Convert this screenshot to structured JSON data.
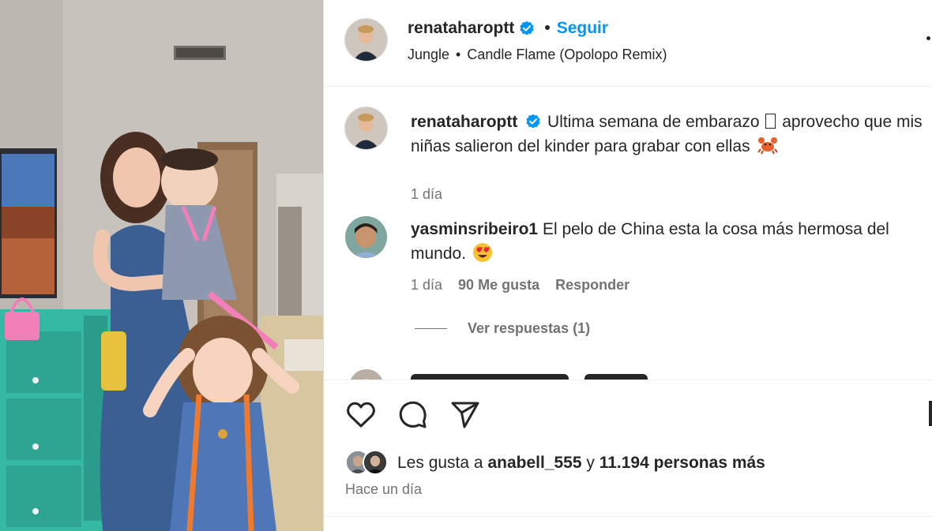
{
  "post_header": {
    "username": "renataharoptt",
    "separator": "•",
    "follow_label": "Seguir",
    "music_artist": "Jungle",
    "music_separator": "•",
    "music_track": "Candle Flame (Opolopo Remix)"
  },
  "caption": {
    "username": "renataharoptt",
    "text_before_emoji": "Ultima semana de embarazo",
    "text_after_emoji": "aprovecho que mis niñas salieron del kinder para grabar con ellas",
    "time": "1 día"
  },
  "comments": [
    {
      "username": "yasminsribeiro1",
      "text": "El pelo de China esta la cosa más hermosa del mundo.",
      "time": "1 día",
      "likes": "90 Me gusta",
      "reply_label": "Responder",
      "view_replies": "Ver respuestas (1)"
    }
  ],
  "likes_summary": {
    "prefix": "Les gusta a",
    "user": "anabell_555",
    "conjunction": "y",
    "others": "11.194 personas más"
  },
  "post_time": "Hace un día",
  "icons": {
    "verified": "verified-badge-icon",
    "like": "heart-icon",
    "comment": "comment-bubble-icon",
    "share": "paper-plane-icon",
    "save": "bookmark-icon",
    "more": "more-options-icon"
  },
  "colors": {
    "link_blue": "#0095f6",
    "verified_blue": "#0095f6",
    "text_primary": "#262626",
    "text_secondary": "#737373"
  }
}
